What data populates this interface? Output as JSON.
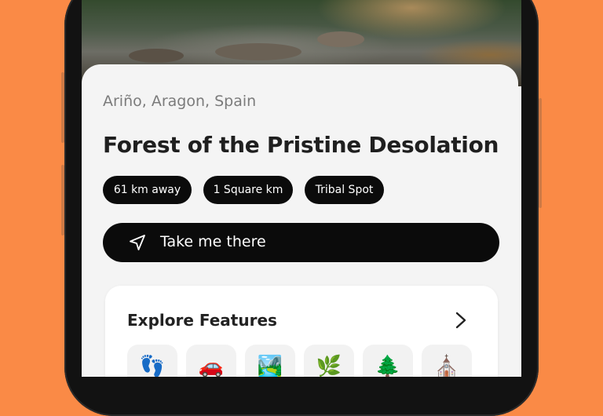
{
  "place": {
    "location": "Ariño, Aragon, Spain",
    "title": "Forest of the Pristine Desolation"
  },
  "chips": [
    "61 km away",
    "1 Square km",
    "Tribal Spot"
  ],
  "cta": {
    "label": "Take me there",
    "icon": "navigation-arrow-icon"
  },
  "features": {
    "title": "Explore Features",
    "icons": [
      {
        "glyph": "👣",
        "name": "footprints-icon"
      },
      {
        "glyph": "🚗",
        "name": "car-icon"
      },
      {
        "glyph": "🏞️",
        "name": "landscape-icon"
      },
      {
        "glyph": "🌿",
        "name": "herb-icon"
      },
      {
        "glyph": "🌲",
        "name": "tree-icon"
      },
      {
        "glyph": "⛪",
        "name": "church-icon"
      }
    ]
  },
  "colors": {
    "background": "#FA8A46",
    "accent": "#0B0B0B",
    "card": "#F4F4F4"
  }
}
